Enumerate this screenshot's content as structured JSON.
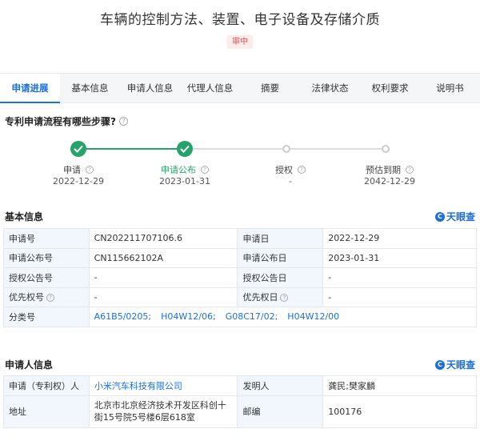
{
  "header": {
    "title": "车辆的控制方法、装置、电子设备及存储介质",
    "status_badge": "审中"
  },
  "tabs": [
    {
      "label": "申请进展",
      "active": true
    },
    {
      "label": "基本信息"
    },
    {
      "label": "申请人信息"
    },
    {
      "label": "代理人信息"
    },
    {
      "label": "摘要"
    },
    {
      "label": "法律状态"
    },
    {
      "label": "权利要求"
    },
    {
      "label": "说明书"
    }
  ],
  "process": {
    "question": "专利申请流程有哪些步骤?",
    "steps": [
      {
        "label": "申请",
        "date": "2022-12-29",
        "done": true
      },
      {
        "label": "申请公布",
        "date": "2023-01-31",
        "done": true
      },
      {
        "label": "授权",
        "date": "-",
        "done": false
      },
      {
        "label": "预估到期",
        "date": "2042-12-29",
        "done": false
      }
    ]
  },
  "basic_info": {
    "title": "基本信息",
    "brand": "天眼查",
    "rows": [
      {
        "k1": "申请号",
        "v1": "CN202211707106.6",
        "k2": "申请日",
        "v2": "2022-12-29"
      },
      {
        "k1": "申请公布号",
        "v1": "CN115662102A",
        "k2": "申请公布日",
        "v2": "2023-01-31"
      },
      {
        "k1": "授权公告号",
        "v1": "-",
        "k2": "授权公告日",
        "v2": "-"
      },
      {
        "k1": "优先权号",
        "v1": "-",
        "k2": "优先权日",
        "v2": "-"
      }
    ],
    "classification_label": "分类号",
    "classifications": [
      "A61B5/0205;",
      "H04W12/06;",
      "G08C17/02;",
      "H04W12/00"
    ]
  },
  "applicant_info": {
    "title": "申请人信息",
    "brand": "天眼查",
    "applicant_label": "申请（专利权）人",
    "applicant": "小米汽车科技有限公司",
    "inventor_label": "发明人",
    "inventor": "龚民;樊家麟",
    "address_label": "地址",
    "address": "北京市北京经济技术开发区科创十街15号院5号楼6层618室",
    "postcode_label": "邮编",
    "postcode": "100176"
  },
  "colors": {
    "accent": "#1a6fd8",
    "success": "#26a36a",
    "badge_bg": "#fdecea",
    "badge_text": "#e04e4e"
  }
}
